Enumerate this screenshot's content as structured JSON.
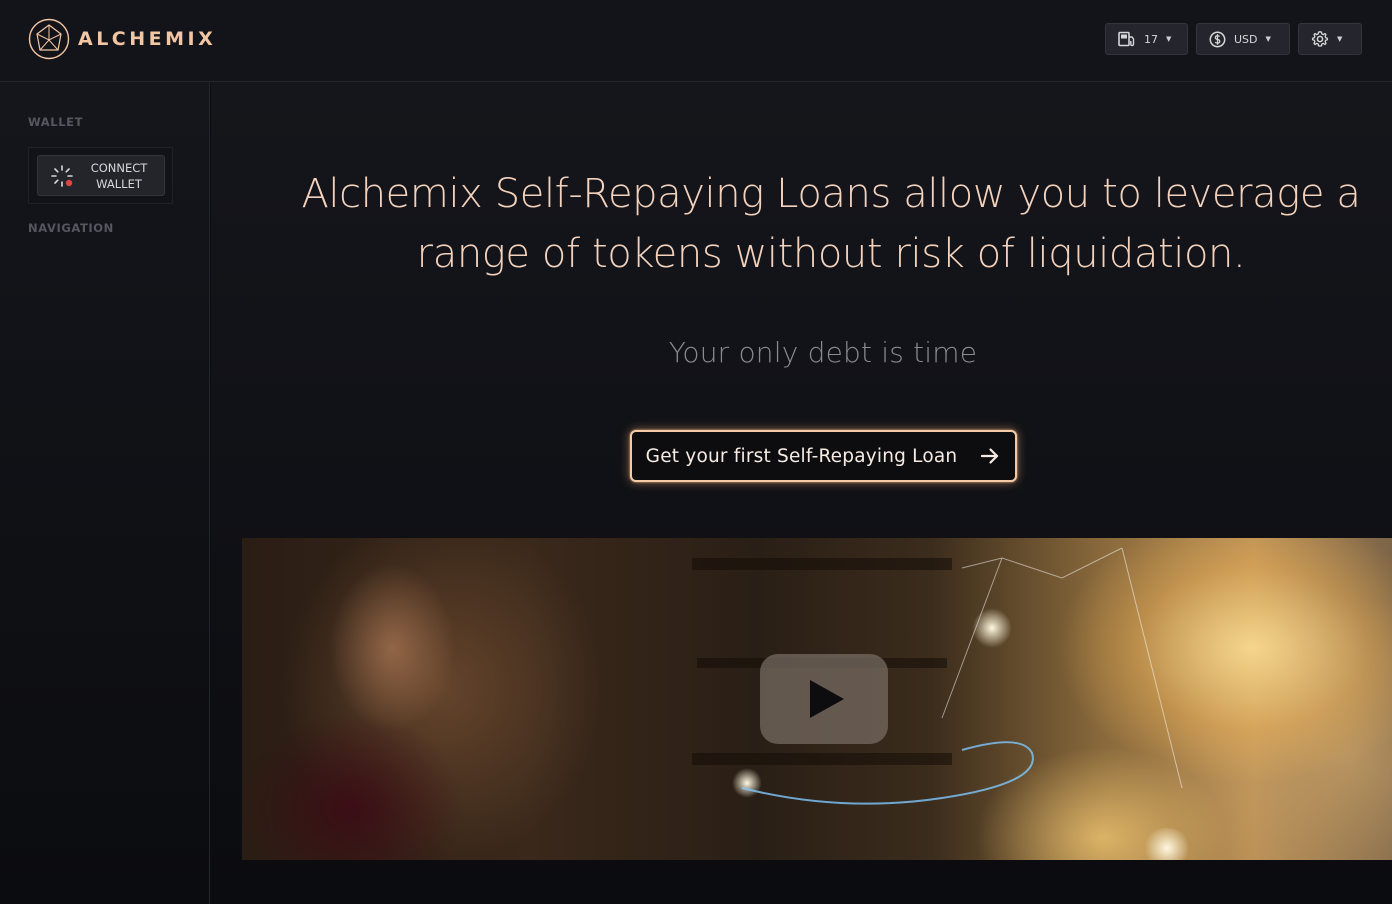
{
  "header": {
    "logo_text": "ALCHEMIX",
    "gas": {
      "value": "17",
      "icon": "gas-pump-icon"
    },
    "currency": {
      "value": "USD",
      "icon": "dollar-circle-icon"
    },
    "settings": {
      "icon": "gear-icon"
    }
  },
  "sidebar": {
    "wallet_label": "WALLET",
    "connect_line1": "CONNECT",
    "connect_line2": "WALLET",
    "navigation_label": "NAVIGATION"
  },
  "main": {
    "headline": "Alchemix Self-Repaying Loans allow you to leverage a range of tokens without risk of liquidation.",
    "tagline": "Your only debt is time",
    "cta_label": "Get your first Self-Repaying Loan"
  },
  "colors": {
    "accent": "#f4c9a5",
    "background": "#0c0d11",
    "status_dot": "#e0453f"
  }
}
